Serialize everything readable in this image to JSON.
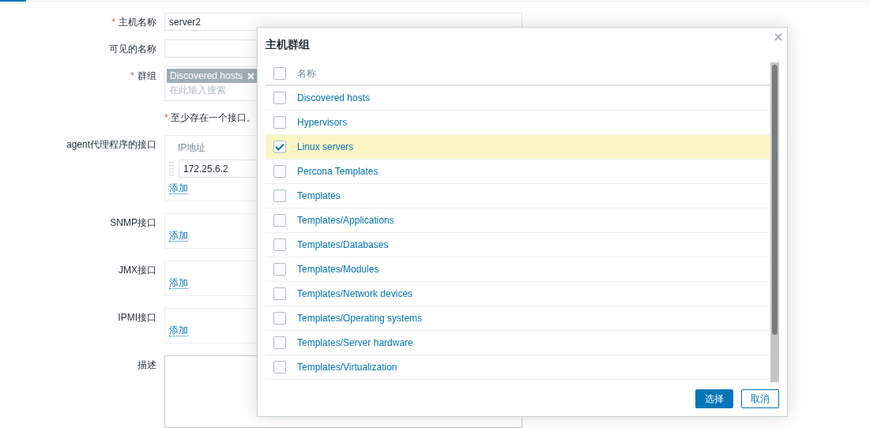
{
  "form": {
    "rows": [
      {
        "kind": "text",
        "label": "主机名称",
        "required_mark": "*",
        "value": "server2"
      },
      {
        "kind": "text",
        "label": "可见的名称"
      },
      {
        "kind": "tags",
        "label": "群组",
        "required_mark": "*",
        "tags": [
          "Discovered hosts"
        ],
        "placeholder": "在此输入搜索"
      },
      {
        "kind": "note",
        "required_mark": "*",
        "text": "至少存在一个接口。"
      },
      {
        "kind": "interface",
        "label": "agent代理程序的接口",
        "column": "IP地址",
        "entries": [
          {
            "ip": "172.25.6.2"
          }
        ],
        "add_link": "添加"
      },
      {
        "kind": "interface",
        "label": "SNMP接口",
        "add_link": "添加"
      },
      {
        "kind": "interface",
        "label": "JMX接口",
        "add_link": "添加"
      },
      {
        "kind": "interface",
        "label": "IPMI接口",
        "add_link": "添加"
      },
      {
        "kind": "textarea",
        "label": "描述"
      }
    ]
  },
  "dialog": {
    "title": "主机群组",
    "header": {
      "label": "名称",
      "checked": false
    },
    "rows": [
      {
        "name": "Discovered hosts",
        "checked": false
      },
      {
        "name": "Hypervisors",
        "checked": false
      },
      {
        "name": "Linux servers",
        "checked": true
      },
      {
        "name": "Percona Templates",
        "checked": false
      },
      {
        "name": "Templates",
        "checked": false
      },
      {
        "name": "Templates/Applications",
        "checked": false
      },
      {
        "name": "Templates/Databases",
        "checked": false
      },
      {
        "name": "Templates/Modules",
        "checked": false
      },
      {
        "name": "Templates/Network devices",
        "checked": false
      },
      {
        "name": "Templates/Operating systems",
        "checked": false
      },
      {
        "name": "Templates/Server hardware",
        "checked": false
      },
      {
        "name": "Templates/Virtualization",
        "checked": false
      }
    ],
    "buttons": [
      {
        "label": "选择",
        "kind": "primary"
      },
      {
        "label": "取消",
        "kind": "secondary"
      }
    ]
  }
}
